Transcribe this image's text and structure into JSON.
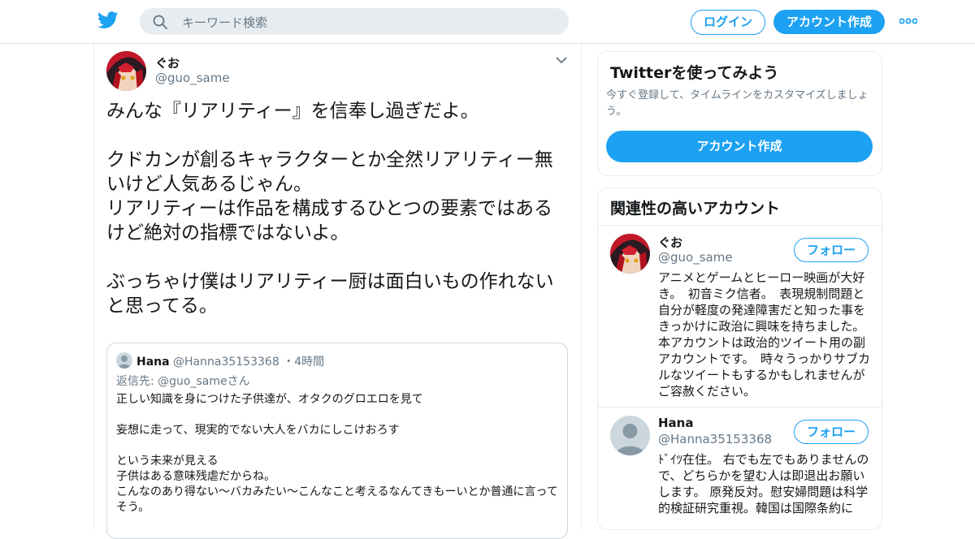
{
  "header": {
    "search_placeholder": "キーワード検索",
    "login_label": "ログイン",
    "signup_label": "アカウント作成"
  },
  "tweet": {
    "name": "ぐお",
    "handle": "@guo_same",
    "text": "みんな『リアリティー』を信奉し過ぎだよ。\n\nクドカンが創るキャラクターとか全然リアリティー無いけど人気あるじゃん。\nリアリティーは作品を構成するひとつの要素ではあるけど絶対の指標ではないよ。\n\nぶっちゃけ僕はリアリティー厨は面白いもの作れないと思ってる。",
    "quote": {
      "name": "Hana",
      "handle": "@Hanna35153368",
      "separator": "・",
      "time": "4時間",
      "reply_prefix": "返信先: ",
      "reply_to": "@guo_sameさん",
      "text": "正しい知識を身につけた子供達が、オタクのグロエロを見て\n\n妄想に走って、現実的でない大人をバカにしこけおろす\n\nという未来が見える\n子供はある意味残虐だからね。\nこんなのあり得ない～バカみたい～こんなこと考えるなんてきもーいとか普通に言ってそう。"
    }
  },
  "signup_card": {
    "title": "Twitterを使ってみよう",
    "description": "今すぐ登録して、タイムラインをカスタマイズしましょう。",
    "button_label": "アカウント作成"
  },
  "related": {
    "title": "関連性の高いアカウント",
    "follow_label": "フォロー",
    "accounts": [
      {
        "name": "ぐお",
        "handle": "@guo_same",
        "bio": "アニメとゲームとヒーロー映画が大好き。　初音ミク信者。　表現規制問題と自分が軽度の発達障害だと知った事をきっかけに政治に興味を持ちました。　本アカウントは政治的ツイート用の副アカウントです。　時々うっかりサブカルなツイートもするかもしれませんがご容赦ください。"
      },
      {
        "name": "Hana",
        "handle": "@Hanna35153368",
        "bio": "ﾄﾞｲﾂ在住。 右でも左でもありませんので、どちらかを望む人は即退出お願いします。 原発反対。慰安婦問題は科学的検証研究重視。韓国は国際条約に"
      }
    ]
  },
  "colors": {
    "accent": "#1da1f2",
    "text": "#14171a",
    "secondary": "#657786",
    "border": "#e6ecf0"
  }
}
